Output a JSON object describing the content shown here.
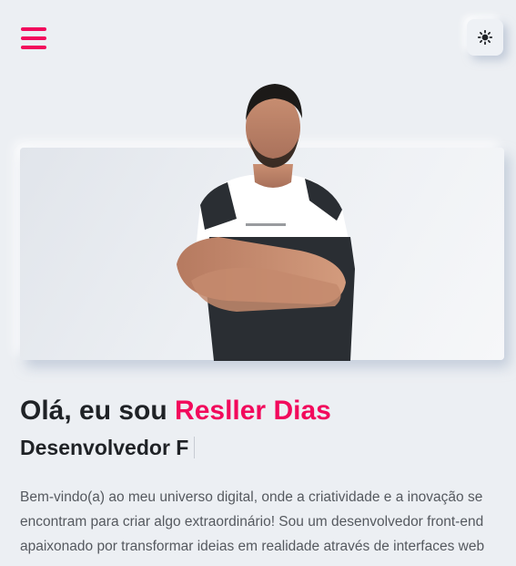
{
  "header": {
    "menu_icon": "hamburger-menu-icon",
    "theme_toggle_icon": "sun-icon"
  },
  "colors": {
    "accent": "#f2095c",
    "background": "#eceff3",
    "text": "#1f2226",
    "body_text": "#55595f"
  },
  "hero": {
    "image": "portrait-photo",
    "greeting": "Olá, eu sou ",
    "name": "Resller Dias",
    "role_typed": "Desenvolvedor F",
    "intro": "Bem-vindo(a) ao meu universo digital, onde a criatividade e a inovação se encontram para criar algo extraordinário! Sou um desenvolvedor front-end apaixonado por transformar ideias em realidade através de interfaces web"
  }
}
